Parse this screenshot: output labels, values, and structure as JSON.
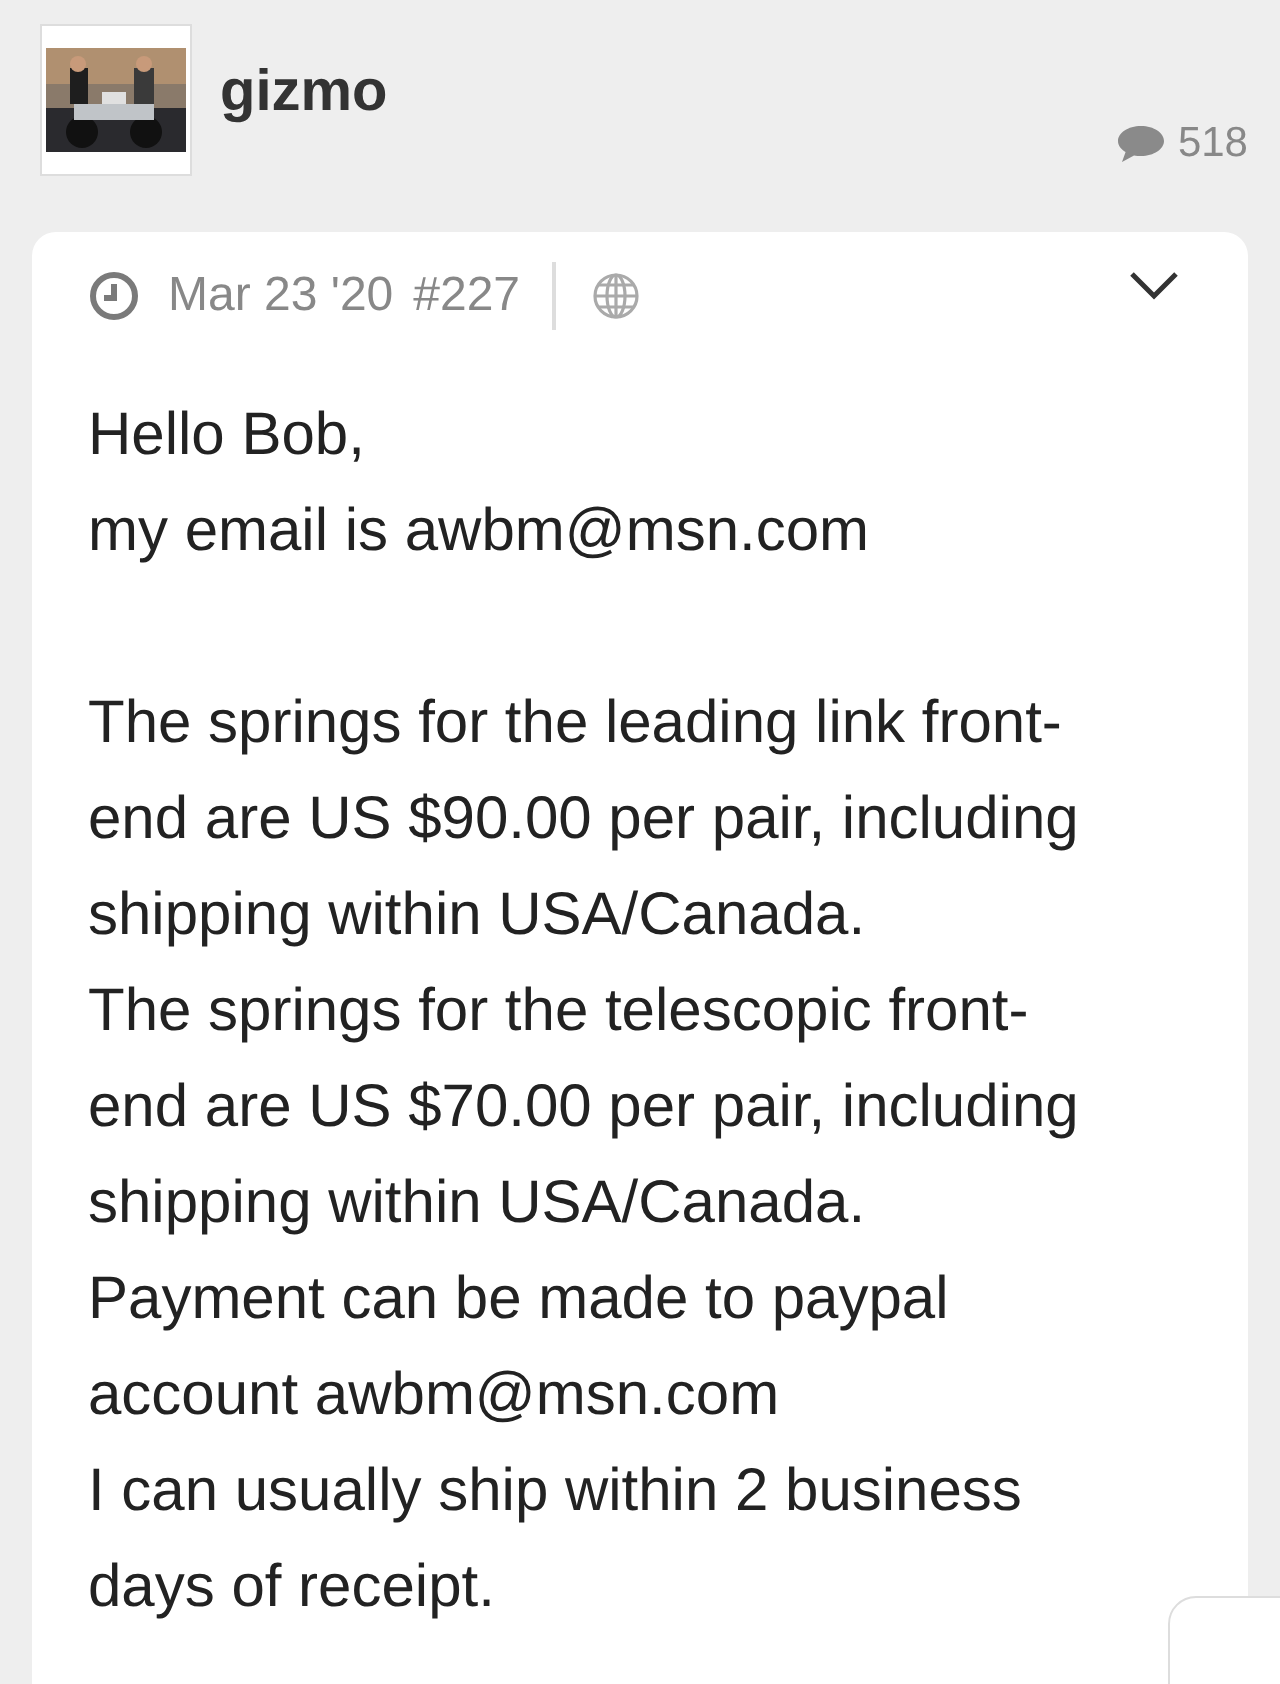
{
  "post": {
    "username": "gizmo",
    "reply_count": "518",
    "date": "Mar 23 '20",
    "post_number": "#227",
    "paragraphs": [
      [
        "Hello Bob,",
        "my email is awbm@msn.com"
      ],
      [
        "The springs for the leading link front-end are US $90.00 per pair, including shipping within USA/Canada.",
        "The springs for the telescopic front-end are US $70.00 per pair, including shipping within USA/Canada.",
        "Payment can be made to paypal account awbm@msn.com",
        "I can usually ship within 2 business days of receipt."
      ]
    ]
  }
}
